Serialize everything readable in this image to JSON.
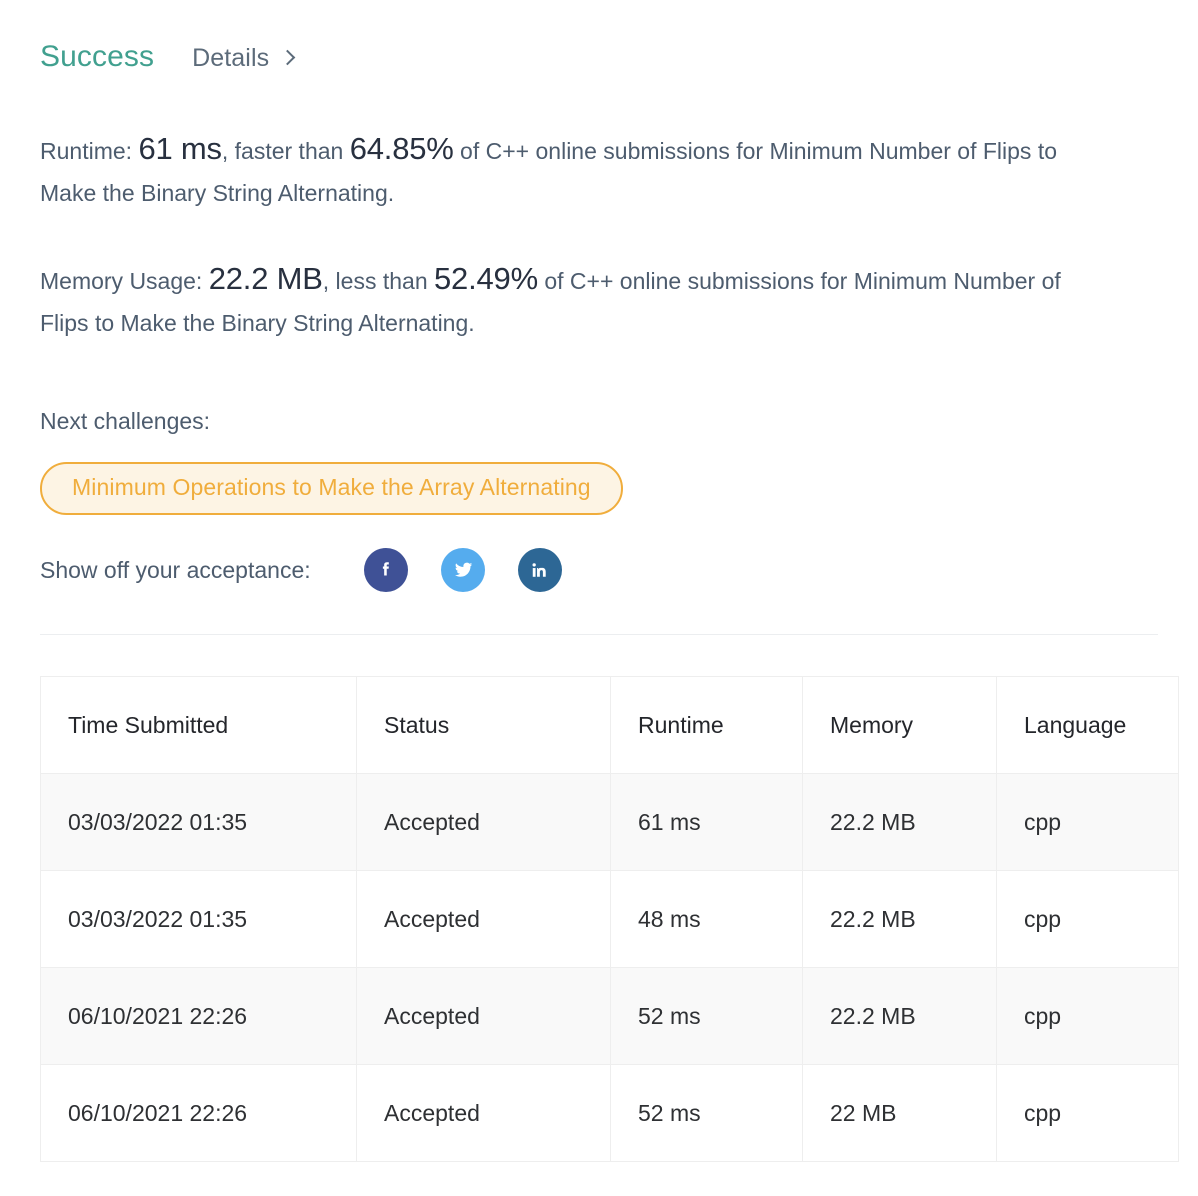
{
  "header": {
    "status": "Success",
    "details_label": "Details",
    "chevron_icon": "chevron-right-icon"
  },
  "results": {
    "runtime": {
      "label": "Runtime:",
      "value": "61 ms",
      "comparator": ", faster than ",
      "percent": "64.85%",
      "suffix": " of C++ online submissions for Minimum Number of Flips to Make the Binary String Alternating."
    },
    "memory": {
      "label": "Memory Usage:",
      "value": "22.2 MB",
      "comparator": ", less than ",
      "percent": "52.49%",
      "suffix": " of C++ online submissions for Minimum Number of Flips to Make the Binary String Alternating."
    }
  },
  "next_challenges": {
    "label": "Next challenges:",
    "items": [
      "Minimum Operations to Make the Array Alternating"
    ]
  },
  "share": {
    "label": "Show off your acceptance:",
    "buttons": [
      {
        "name": "facebook",
        "icon": "facebook-icon",
        "color": "#3f5196"
      },
      {
        "name": "twitter",
        "icon": "twitter-icon",
        "color": "#55acee"
      },
      {
        "name": "linkedin",
        "icon": "linkedin-icon",
        "color": "#2d6795"
      }
    ]
  },
  "submissions_table": {
    "columns": [
      "Time Submitted",
      "Status",
      "Runtime",
      "Memory",
      "Language"
    ],
    "rows": [
      {
        "time": "03/03/2022 01:35",
        "status": "Accepted",
        "runtime": "61 ms",
        "memory": "22.2 MB",
        "language": "cpp"
      },
      {
        "time": "03/03/2022 01:35",
        "status": "Accepted",
        "runtime": "48 ms",
        "memory": "22.2 MB",
        "language": "cpp"
      },
      {
        "time": "06/10/2021 22:26",
        "status": "Accepted",
        "runtime": "52 ms",
        "memory": "22.2 MB",
        "language": "cpp"
      },
      {
        "time": "06/10/2021 22:26",
        "status": "Accepted",
        "runtime": "52 ms",
        "memory": "22 MB",
        "language": "cpp"
      }
    ]
  },
  "colors": {
    "success_teal": "#41a08f",
    "accepted_teal": "#2f9183",
    "accent_orange": "#f0ad3c",
    "pill_bg": "#fdf4e4",
    "body_text": "#4d5c6e"
  }
}
